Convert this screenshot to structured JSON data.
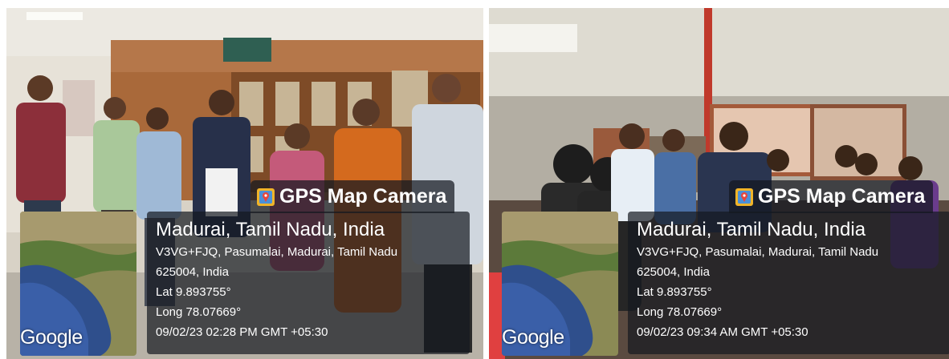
{
  "photos": [
    {
      "camera_label": "GPS Map Camera",
      "map_brand": "Google",
      "location_title": "Madurai, Tamil Nadu, India",
      "address_line1": "V3VG+FJQ, Pasumalai, Madurai, Tamil Nadu",
      "address_line2": "625004, India",
      "lat": "Lat 9.893755°",
      "long": "Long 78.07669°",
      "datetime": "09/02/23 02:28 PM GMT +05:30"
    },
    {
      "camera_label": "GPS Map Camera",
      "map_brand": "Google",
      "location_title": "Madurai, Tamil Nadu, India",
      "address_line1": "V3VG+FJQ, Pasumalai, Madurai, Tamil Nadu",
      "address_line2": "625004, India",
      "lat": "Lat 9.893755°",
      "long": "Long 78.07669°",
      "datetime": "09/02/23 09:34 AM GMT +05:30"
    }
  ]
}
